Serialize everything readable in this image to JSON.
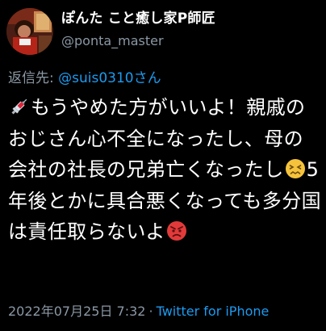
{
  "tweet": {
    "author": {
      "display_name": "ぽんた こと癒し家P師匠",
      "handle": "@ponta_master",
      "avatar_icon": "avatar-image"
    },
    "reply": {
      "label": "返信先: ",
      "target": "@suis0310さん"
    },
    "body": {
      "leading_emoji": "syringe-emoji",
      "part1": "もうやめた方がいいよ！親戚のおじさん心不全になったし、母の会社の社長の兄弟亡くなったし",
      "middle_emoji": "confounded-face-emoji",
      "part2": "5年後とかに具合悪くなっても多分国は責任取らないよ",
      "trailing_emoji": "angry-face-emoji"
    },
    "footer": {
      "timestamp": "2022年07月25日 7:32",
      "separator": "·",
      "source": "Twitter for iPhone"
    },
    "colors": {
      "background": "#000000",
      "text": "#ffffff",
      "secondary": "#8b98a5",
      "link": "#1d9bf0"
    }
  }
}
